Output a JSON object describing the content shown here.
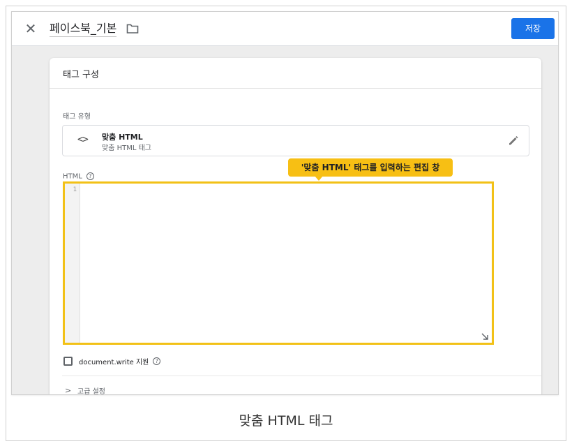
{
  "topbar": {
    "title": "페이스북_기본",
    "save_label": "저장"
  },
  "card": {
    "title": "태그 구성",
    "tag_type_label": "태그 유형",
    "tag_type": {
      "name": "맞춤 HTML",
      "description": "맞춤 HTML 태그"
    },
    "html_label": "HTML",
    "editor": {
      "line_numbers": [
        "1"
      ],
      "content": ""
    },
    "document_write_label": "document.write 지원",
    "advanced_label": "고급 설정"
  },
  "callout": {
    "text": "'맞춤 HTML' 태그를 입력하는 편집 창",
    "color": "#f7bf14"
  },
  "caption": "맞춤 HTML 태그",
  "colors": {
    "accent": "#1a73e8",
    "highlight": "#f2c117"
  },
  "icons": {
    "close": "close-icon",
    "folder": "folder-icon",
    "code": "code-icon",
    "edit": "pencil-icon",
    "help": "help-icon",
    "resize": "resize-icon",
    "chevron": "chevron-right-icon"
  }
}
